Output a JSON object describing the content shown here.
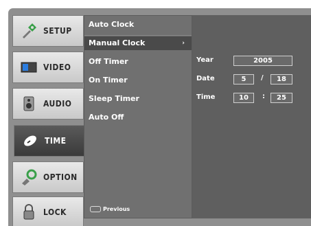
{
  "categories": [
    {
      "label": "SETUP",
      "icon": "setup-icon"
    },
    {
      "label": "VIDEO",
      "icon": "video-icon"
    },
    {
      "label": "AUDIO",
      "icon": "audio-icon"
    },
    {
      "label": "TIME",
      "icon": "clock-icon",
      "active": true
    },
    {
      "label": "OPTION",
      "icon": "option-icon"
    },
    {
      "label": "LOCK",
      "icon": "lock-icon"
    }
  ],
  "submenu": {
    "items": [
      "Auto Clock",
      "Manual Clock",
      "Off Timer",
      "On Timer",
      "Sleep Timer",
      "Auto Off"
    ],
    "selected_index": 1,
    "selected_arrow": "›",
    "previous_label": "Previous"
  },
  "detail": {
    "year_label": "Year",
    "year_value": "2005",
    "date_label": "Date",
    "date_month": "5",
    "date_sep": "/",
    "date_day": "18",
    "time_label": "Time",
    "time_hour": "10",
    "time_sep": ":",
    "time_minute": "25"
  }
}
